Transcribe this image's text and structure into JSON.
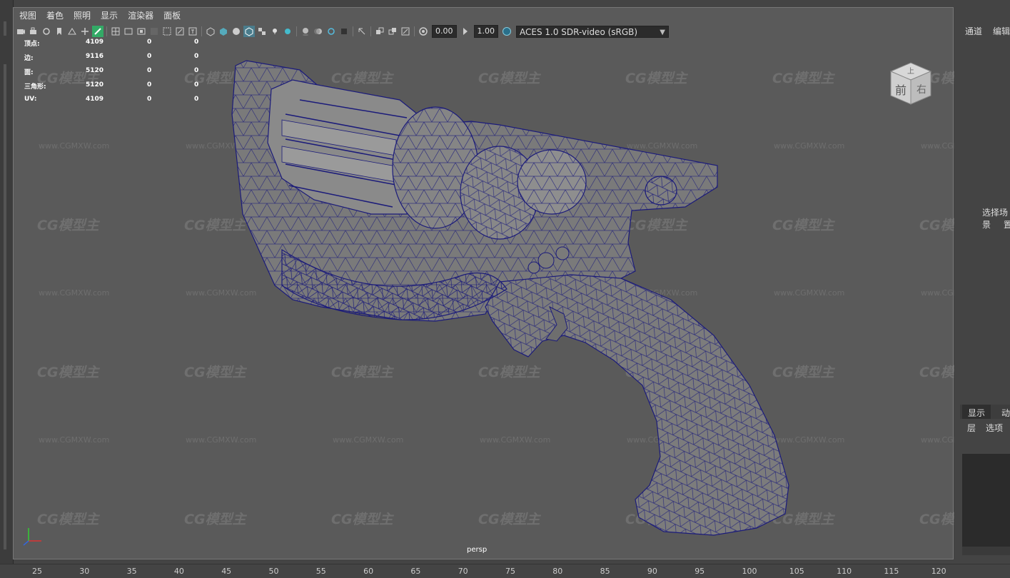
{
  "menu": [
    "视图",
    "着色",
    "照明",
    "显示",
    "渲染器",
    "面板"
  ],
  "toolbar": {
    "exposure_value": "0.00",
    "gamma_value": "1.00",
    "color_space": "ACES 1.0 SDR-video (sRGB)"
  },
  "hud": {
    "rows": [
      {
        "label": "顶点:",
        "v1": "4109",
        "v2": "0",
        "v3": "0"
      },
      {
        "label": "边:",
        "v1": "9116",
        "v2": "0",
        "v3": "0"
      },
      {
        "label": "面:",
        "v1": "5120",
        "v2": "0",
        "v3": "0"
      },
      {
        "label": "三角形:",
        "v1": "5120",
        "v2": "0",
        "v3": "0"
      },
      {
        "label": "UV:",
        "v1": "4109",
        "v2": "0",
        "v3": "0"
      }
    ]
  },
  "viewcube": {
    "top": "上",
    "front": "前",
    "right": "右"
  },
  "camera_label": "persp",
  "watermark": {
    "brand": "CG模型主",
    "url": "www.CGMXW.com"
  },
  "right_panel": {
    "tab_channels": "通道",
    "tab_edit": "编辑",
    "hint_line1": "选择场景",
    "hint_line2": "置",
    "tab_display": "显示",
    "tab_anim": "动",
    "menu_layers": "层",
    "menu_options": "选项"
  },
  "timeline": {
    "ticks": [
      "25",
      "30",
      "35",
      "40",
      "45",
      "50",
      "55",
      "60",
      "65",
      "70",
      "75",
      "80",
      "85",
      "90",
      "95",
      "100",
      "105",
      "110",
      "115",
      "120"
    ]
  },
  "colors": {
    "wireframe": "#1b1b7a",
    "mesh_fill": "#7a7a7a",
    "viewport_bg": "#5a5a5a"
  }
}
